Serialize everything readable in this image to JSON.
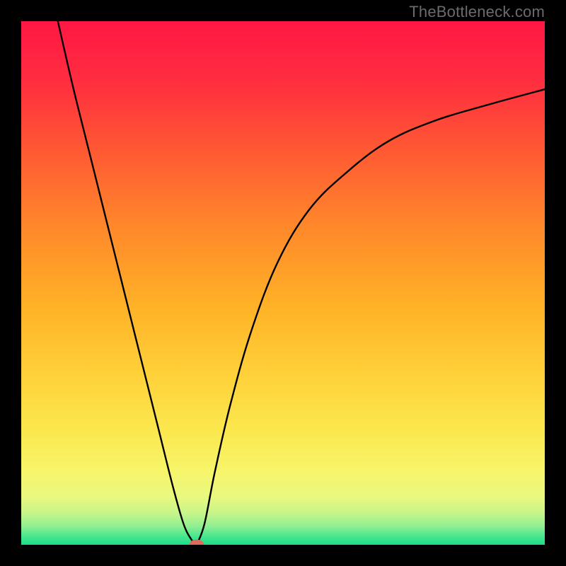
{
  "watermark": "TheBottleneck.com",
  "chart_data": {
    "type": "line",
    "title": "",
    "xlabel": "",
    "ylabel": "",
    "xlim": [
      0,
      100
    ],
    "ylim": [
      0,
      100
    ],
    "grid": false,
    "legend": false,
    "background_gradient_stops": [
      {
        "pct": 0,
        "color": "#ff1744"
      },
      {
        "pct": 12,
        "color": "#ff2f3f"
      },
      {
        "pct": 25,
        "color": "#ff5a33"
      },
      {
        "pct": 40,
        "color": "#ff8a2a"
      },
      {
        "pct": 55,
        "color": "#ffb327"
      },
      {
        "pct": 68,
        "color": "#ffd23a"
      },
      {
        "pct": 78,
        "color": "#fbe74d"
      },
      {
        "pct": 86,
        "color": "#f7f56a"
      },
      {
        "pct": 91,
        "color": "#e8f87f"
      },
      {
        "pct": 94,
        "color": "#c6f58a"
      },
      {
        "pct": 96.5,
        "color": "#8fef92"
      },
      {
        "pct": 98.5,
        "color": "#44e68e"
      },
      {
        "pct": 100,
        "color": "#1bdc88"
      }
    ],
    "series": [
      {
        "name": "curve-left",
        "x": [
          7,
          10,
          14,
          18,
          22,
          26,
          29,
          31,
          32.5,
          33.5
        ],
        "y": [
          100,
          87,
          71,
          55,
          39,
          23,
          11,
          4,
          1,
          0
        ]
      },
      {
        "name": "curve-right",
        "x": [
          33.5,
          35,
          37,
          40,
          44,
          49,
          55,
          62,
          70,
          79,
          89,
          100
        ],
        "y": [
          0,
          4,
          14,
          27,
          41,
          54,
          64,
          71,
          77,
          81,
          84,
          87
        ]
      }
    ],
    "min_marker": {
      "x": 33.5,
      "y": 0,
      "rx": 1.4,
      "ry": 1.0,
      "color": "#e0685c"
    },
    "curve_color": "#000000",
    "curve_width": 2.4
  }
}
